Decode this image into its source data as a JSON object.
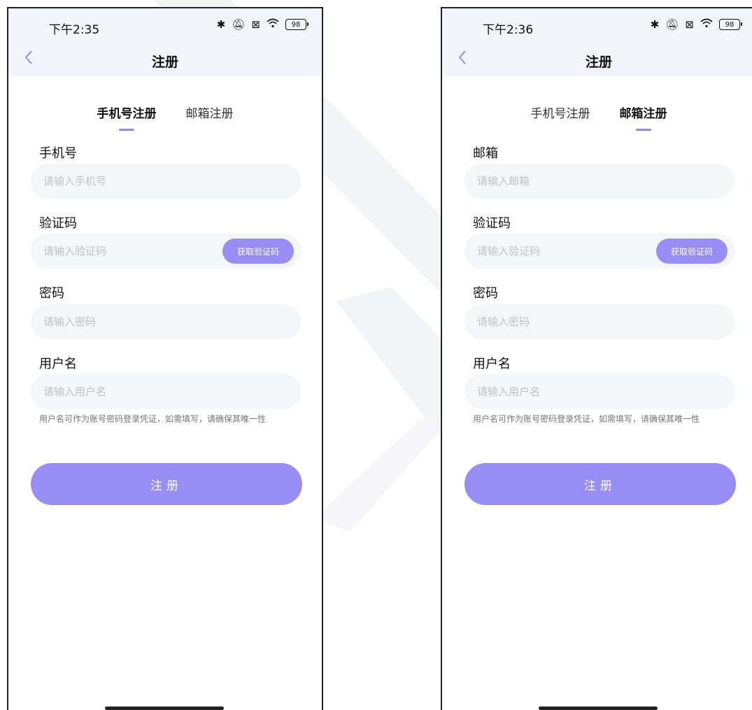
{
  "colors": {
    "accent": "#978df4",
    "tab_underline": "#8f86f0",
    "header_bg": "#f2f5fb",
    "field_bg": "#f5f6f8"
  },
  "icons": {
    "back": "chevron-left-icon",
    "bluetooth": "bluetooth-icon",
    "mute": "mute-icon",
    "sim": "no-sim-icon",
    "wifi": "wifi-icon",
    "battery": "battery-icon"
  },
  "left": {
    "status": {
      "time": "下午2:35",
      "battery": "98"
    },
    "title": "注册",
    "tabs": {
      "phone": "手机号注册",
      "email": "邮箱注册"
    },
    "account": {
      "label": "手机号",
      "placeholder": "请输入手机号"
    },
    "code": {
      "label": "验证码",
      "placeholder": "请输入验证码",
      "button": "获取验证码"
    },
    "password": {
      "label": "密码",
      "placeholder": "请输入密码"
    },
    "username": {
      "label": "用户名",
      "placeholder": "请输入用户名",
      "hint": "用户名可作为账号密码登录凭证，如需填写，请确保其唯一性"
    },
    "submit": "注册"
  },
  "right": {
    "status": {
      "time": "下午2:36",
      "battery": "98"
    },
    "title": "注册",
    "tabs": {
      "phone": "手机号注册",
      "email": "邮箱注册"
    },
    "account": {
      "label": "邮箱",
      "placeholder": "请输入邮箱"
    },
    "code": {
      "label": "验证码",
      "placeholder": "请输入验证码",
      "button": "获取验证码"
    },
    "password": {
      "label": "密码",
      "placeholder": "请输入密码"
    },
    "username": {
      "label": "用户名",
      "placeholder": "请输入用户名",
      "hint": "用户名可作为账号密码登录凭证，如需填写，请确保其唯一性"
    },
    "submit": "注册"
  }
}
